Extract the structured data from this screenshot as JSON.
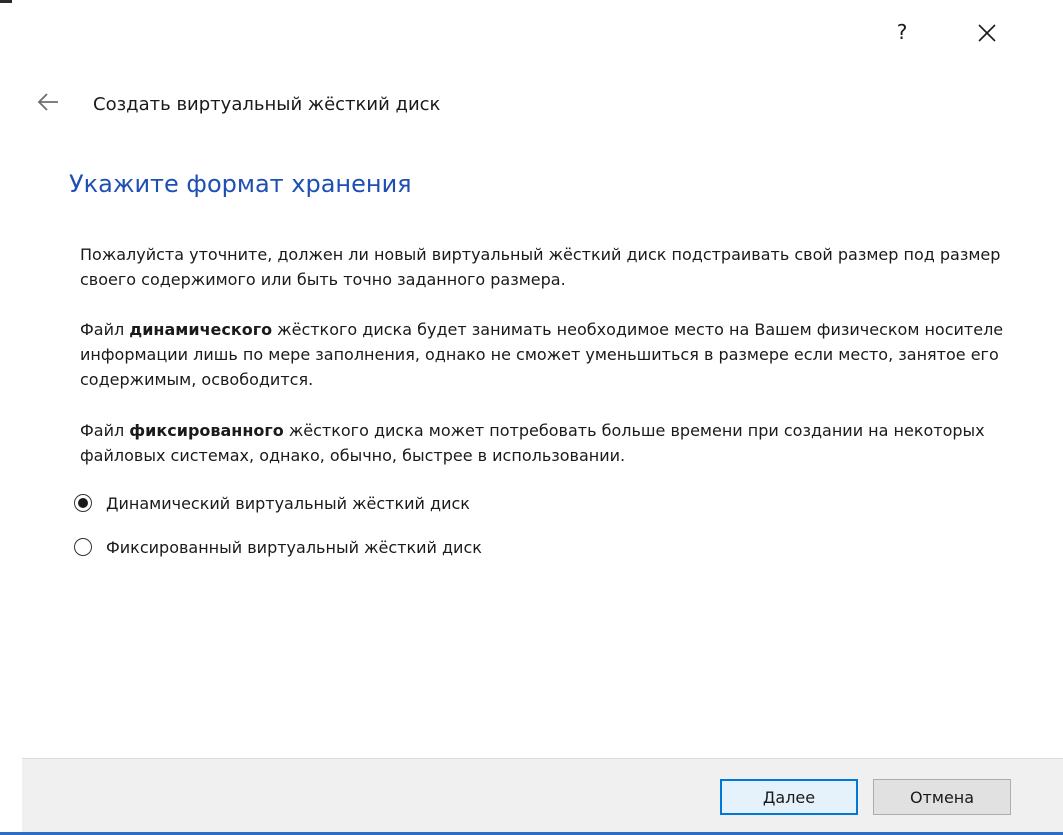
{
  "window": {
    "help_label": "?",
    "close_icon": "close-icon",
    "back_icon": "back-arrow-icon"
  },
  "wizard": {
    "title": "Создать виртуальный жёсткий диск",
    "heading": "Укажите формат хранения",
    "paragraph1": "Пожалуйста уточните, должен ли новый виртуальный жёсткий диск подстраивать свой размер под размер своего содержимого или быть точно заданного размера.",
    "paragraph2": {
      "prefix": "Файл ",
      "bold": "динамического",
      "suffix": " жёсткого диска будет занимать необходимое место на Вашем физическом носителе информации лишь по мере заполнения, однако не сможет уменьшиться в размере если место, занятое его содержимым, освободится."
    },
    "paragraph3": {
      "prefix": "Файл ",
      "bold": "фиксированного",
      "suffix": " жёсткого диска может потребовать больше времени при создании на некоторых файловых системах, однако, обычно, быстрее в использовании."
    },
    "options": [
      {
        "label": "Динамический виртуальный жёсткий диск",
        "selected": true
      },
      {
        "label": "Фиксированный виртуальный жёсткий диск",
        "selected": false
      }
    ]
  },
  "footer": {
    "next_label": "Далее",
    "cancel_label": "Отмена"
  },
  "colors": {
    "heading": "#1e4fb5",
    "default_button_border": "#0078d7",
    "footer_bg": "#f0f0f0"
  }
}
